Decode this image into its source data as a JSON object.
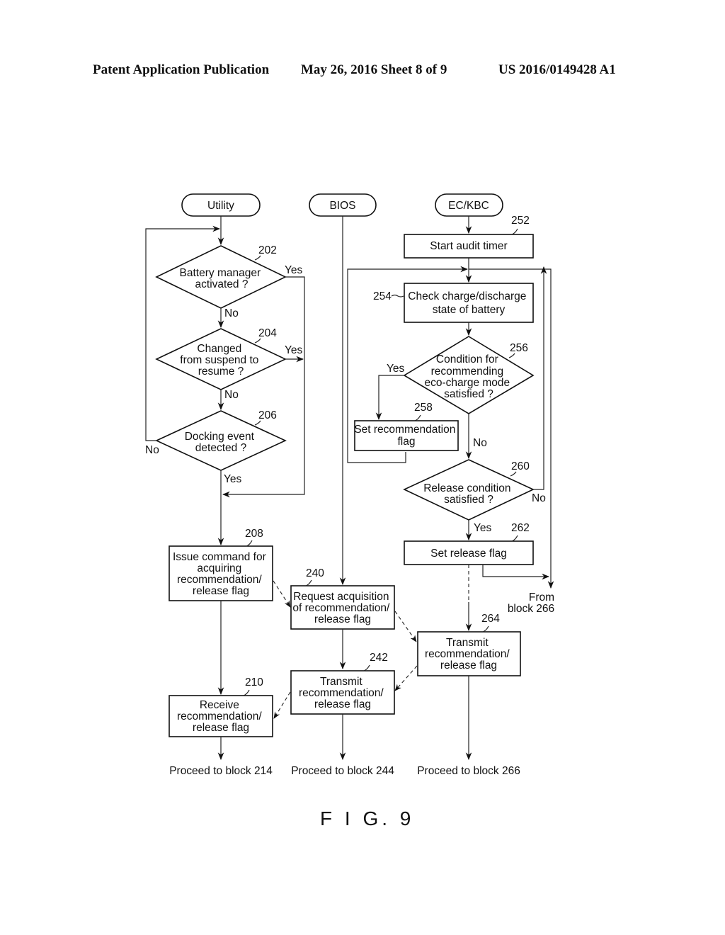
{
  "header": {
    "left": "Patent Application Publication",
    "middle": "May 26, 2016  Sheet 8 of 9",
    "right": "US 2016/0149428 A1"
  },
  "figure_label": "F I G. 9",
  "terminals": {
    "utility": "Utility",
    "bios": "BIOS",
    "eckbc": "EC/KBC"
  },
  "blocks": {
    "b202": {
      "ref": "202",
      "lines": [
        "Battery manager",
        "activated ?"
      ]
    },
    "b204": {
      "ref": "204",
      "lines": [
        "Changed",
        "from suspend to",
        "resume ?"
      ]
    },
    "b206": {
      "ref": "206",
      "lines": [
        "Docking event",
        "detected ?"
      ]
    },
    "b208": {
      "ref": "208",
      "lines": [
        "Issue command for",
        "acquiring",
        "recommendation/",
        "release flag"
      ]
    },
    "b210": {
      "ref": "210",
      "lines": [
        "Receive",
        "recommendation/",
        "release flag"
      ]
    },
    "b240": {
      "ref": "240",
      "lines": [
        "Request acquisition",
        "of recommendation/",
        "release flag"
      ]
    },
    "b242": {
      "ref": "242",
      "lines": [
        "Transmit",
        "recommendation/",
        "release flag"
      ]
    },
    "b252": {
      "ref": "252",
      "lines": [
        "Start audit timer"
      ]
    },
    "b254": {
      "ref": "254",
      "lines": [
        "Check charge/discharge",
        "state of battery"
      ]
    },
    "b256": {
      "ref": "256",
      "lines": [
        "Condition for",
        "recommending",
        "eco-charge mode",
        "satisfied ?"
      ]
    },
    "b258": {
      "ref": "258",
      "lines": [
        "Set recommendation",
        "flag"
      ]
    },
    "b260": {
      "ref": "260",
      "lines": [
        "Release condition",
        "satisfied ?"
      ]
    },
    "b262": {
      "ref": "262",
      "lines": [
        "Set release flag"
      ]
    },
    "b264": {
      "ref": "264",
      "lines": [
        "Transmit",
        "recommendation/",
        "release flag"
      ]
    }
  },
  "branch_labels": {
    "yes": "Yes",
    "no": "No"
  },
  "from_block": [
    "From",
    "block 266"
  ],
  "proceed": {
    "p214": "Proceed to block 214",
    "p244": "Proceed to block 244",
    "p266": "Proceed to block 266"
  }
}
